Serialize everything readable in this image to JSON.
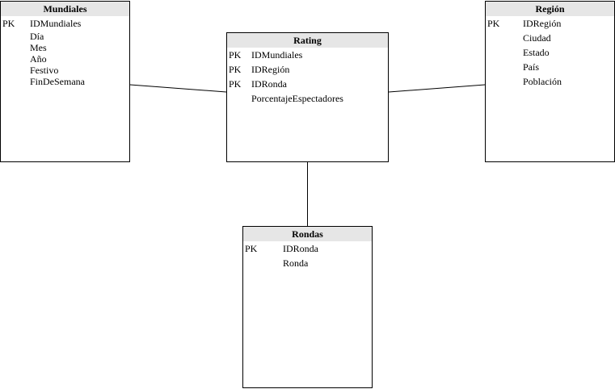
{
  "entities": {
    "mundiales": {
      "title": "Mundiales",
      "rows": [
        {
          "key": "PK",
          "attr": "IDMundiales"
        },
        {
          "key": "",
          "attr": "Día"
        },
        {
          "key": "",
          "attr": "Mes"
        },
        {
          "key": "",
          "attr": "Año"
        },
        {
          "key": "",
          "attr": "Festivo"
        },
        {
          "key": "",
          "attr": "FinDeSemana"
        }
      ]
    },
    "rating": {
      "title": "Rating",
      "rows": [
        {
          "key": "PK",
          "attr": "IDMundiales"
        },
        {
          "key": "PK",
          "attr": "IDRegión"
        },
        {
          "key": "PK",
          "attr": "IDRonda"
        },
        {
          "key": "",
          "attr": "PorcentajeEspectadores"
        }
      ]
    },
    "region": {
      "title": "Región",
      "rows": [
        {
          "key": "PK",
          "attr": "IDRegión"
        },
        {
          "key": "",
          "attr": "Ciudad"
        },
        {
          "key": "",
          "attr": "Estado"
        },
        {
          "key": "",
          "attr": "País"
        },
        {
          "key": "",
          "attr": "Población"
        }
      ]
    },
    "rondas": {
      "title": "Rondas",
      "rows": [
        {
          "key": "PK",
          "attr": "IDRonda"
        },
        {
          "key": "",
          "attr": "Ronda"
        }
      ]
    }
  },
  "colors": {
    "header_fill": "#e6e6e6",
    "border": "#000000",
    "background": "#ffffff"
  }
}
